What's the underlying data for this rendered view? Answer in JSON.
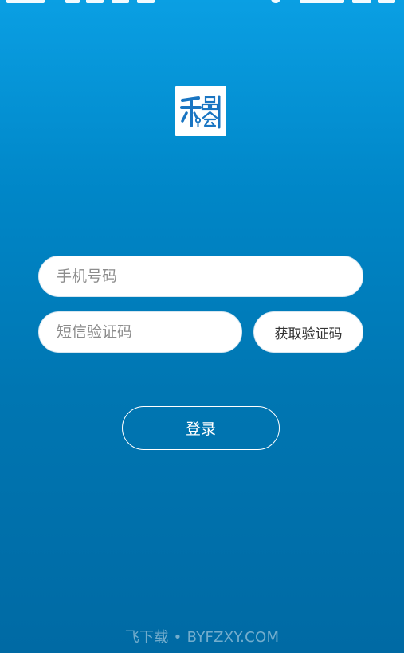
{
  "login": {
    "phone_placeholder": "手机号码",
    "phone_value": "",
    "sms_placeholder": "短信验证码",
    "sms_value": "",
    "get_code_label": "获取验证码",
    "login_label": "登录"
  },
  "logo": {
    "icon": "app-logo-icon",
    "text": "禾品会"
  },
  "watermark": {
    "text": "飞下载 • BYFZXY.COM"
  },
  "colors": {
    "background_top": "#0a9fe3",
    "background_bottom": "#006aa4",
    "logo_blue": "#1a75c2",
    "field_bg": "#ffffff",
    "placeholder": "#8c8c8c"
  }
}
